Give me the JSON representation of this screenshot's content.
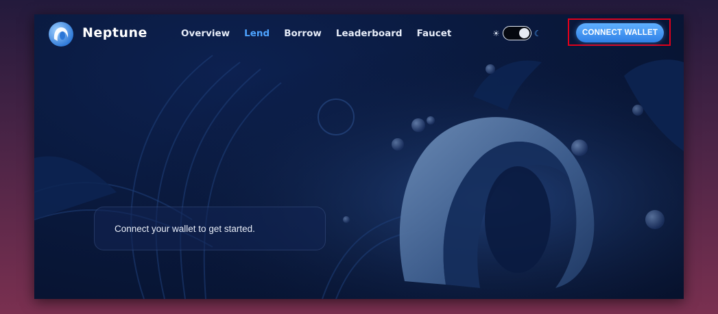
{
  "app": {
    "brand": "Neptune"
  },
  "nav": {
    "links": [
      "Overview",
      "Lend",
      "Borrow",
      "Leaderboard",
      "Faucet"
    ],
    "active": "Lend"
  },
  "theme_toggle": {
    "left_icon": "sun-icon",
    "right_icon": "moon-icon",
    "mode": "dark"
  },
  "header": {
    "connect_label": "CONNECT WALLET"
  },
  "main": {
    "message": "Connect your wallet to get started."
  },
  "colors": {
    "accent": "#4da3ff",
    "button": "#3a8ff0",
    "highlight_box": "#e0001b",
    "background": "#0a1a3f"
  }
}
